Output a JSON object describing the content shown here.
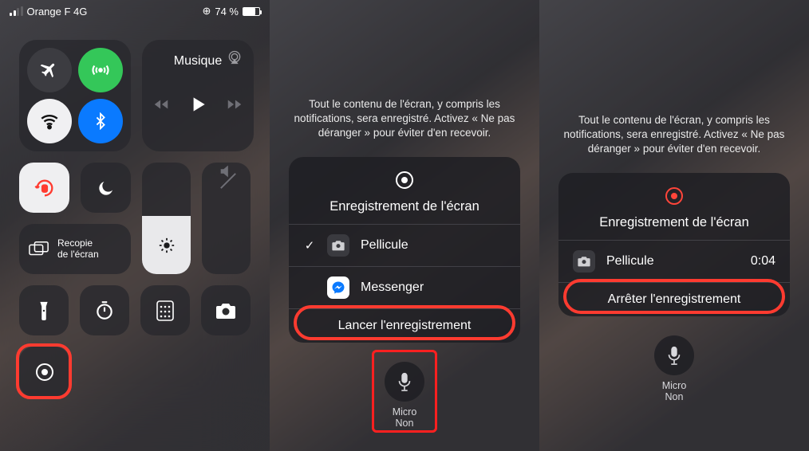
{
  "status": {
    "carrier": "Orange F  4G",
    "battery_pct": "74 %"
  },
  "panel1": {
    "music_label": "Musique",
    "screen_mirror": "Recopie\nde l'écran"
  },
  "warning": "Tout le contenu de l'écran, y compris les notifications, sera enregistré. Activez « Ne pas déranger » pour éviter d'en recevoir.",
  "record_title": "Enregistrement de l'écran",
  "apps": {
    "pellicule": "Pellicule",
    "messenger": "Messenger"
  },
  "start_label": "Lancer l'enregistrement",
  "stop_label": "Arrêter l'enregistrement",
  "elapsed": "0:04",
  "micro_label": "Micro",
  "micro_state": "Non"
}
